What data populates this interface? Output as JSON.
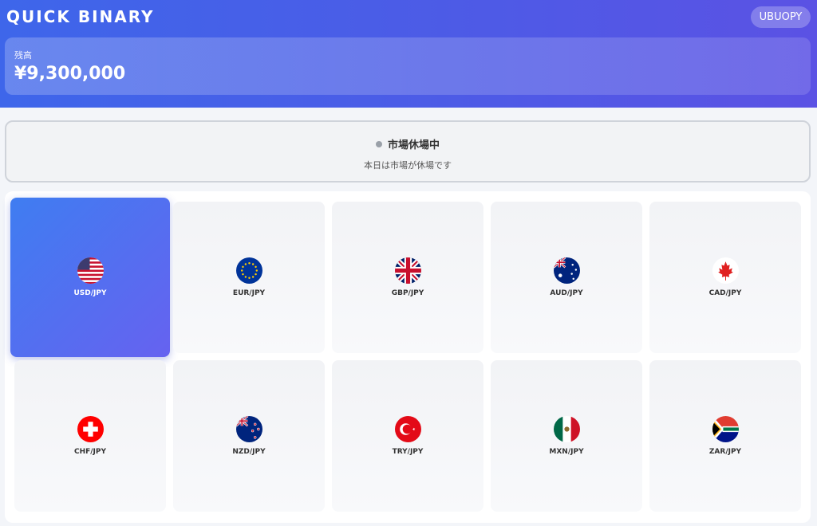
{
  "app": {
    "logo": "QUICK BINARY",
    "user": "UBUOPY"
  },
  "balance": {
    "label": "残高",
    "value": "¥9,300,000"
  },
  "market": {
    "title": "市場休場中",
    "subtitle": "本日は市場が休場です"
  },
  "pairs": [
    {
      "label": "USD/JPY",
      "flag": "usa-flag-icon",
      "active": true
    },
    {
      "label": "EUR/JPY",
      "flag": "eu-flag-icon",
      "active": false
    },
    {
      "label": "GBP/JPY",
      "flag": "uk-flag-icon",
      "active": false
    },
    {
      "label": "AUD/JPY",
      "flag": "australia-flag-icon",
      "active": false
    },
    {
      "label": "CAD/JPY",
      "flag": "canada-flag-icon",
      "active": false
    },
    {
      "label": "CHF/JPY",
      "flag": "switzerland-flag-icon",
      "active": false
    },
    {
      "label": "NZD/JPY",
      "flag": "new-zealand-flag-icon",
      "active": false
    },
    {
      "label": "TRY/JPY",
      "flag": "turkey-flag-icon",
      "active": false
    },
    {
      "label": "MXN/JPY",
      "flag": "mexico-flag-icon",
      "active": false
    },
    {
      "label": "ZAR/JPY",
      "flag": "south-africa-flag-icon",
      "active": false
    }
  ],
  "colors": {
    "header_start": "#3e66ea",
    "header_end": "#5b52e4",
    "active_tile": "#4f72f0",
    "status_dot": "#9aa0a8"
  }
}
